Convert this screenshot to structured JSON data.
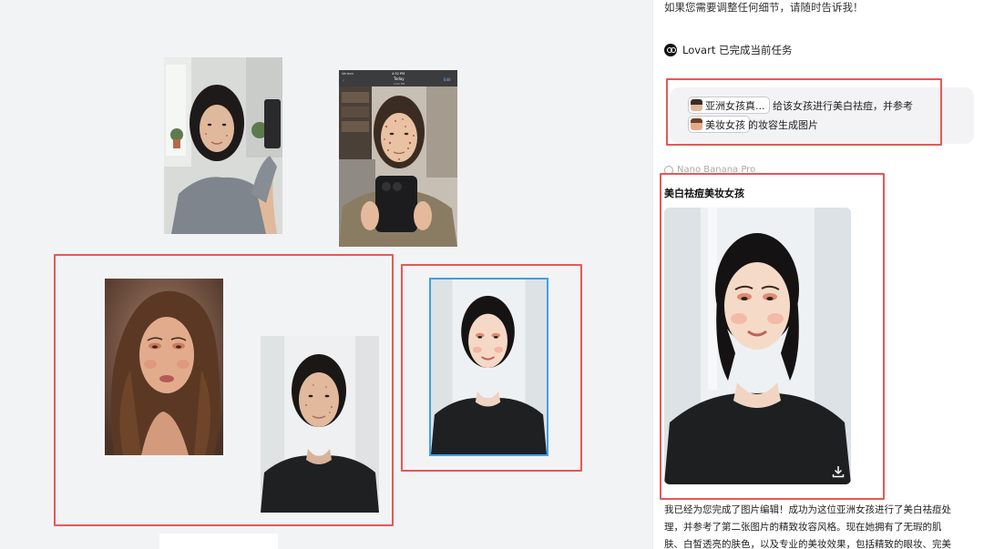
{
  "chat": {
    "intro_message": "如果您需要调整任何细节，请随时告诉我！",
    "task_status": "Lovart 已完成当前任务",
    "prompt": {
      "chip1_label": "亚洲女孩真...",
      "text_after_chip1": "给该女孩进行美白祛痘，并参考",
      "chip2_label": "美妆女孩",
      "text_after_chip2": "的妆容生成图片"
    },
    "model_name": "Nano Banana Pro",
    "result_title": "美白祛痘美妆女孩",
    "description_lines": [
      "我已经为您完成了图片编辑！成功为这位亚洲女孩进行了美白祛痘处",
      "理，并参考了第二张图片的精致妆容风格。现在她拥有了无瑕的肌",
      "肤、白皙透亮的肤色，以及专业的美妆效果，包括精致的眼妆、完美"
    ]
  },
  "phone_screen": {
    "carrier": "Verizon",
    "time": "4:32 PM",
    "date_label": "Today",
    "sub_time": "4:32 PM",
    "edit_label": "Edit"
  },
  "colors": {
    "highlight_red": "#e85757",
    "selection_blue": "#3aa0ef"
  },
  "icons": {
    "task_logo": "lovart-logo-icon",
    "model": "model-icon",
    "download": "download-icon"
  }
}
